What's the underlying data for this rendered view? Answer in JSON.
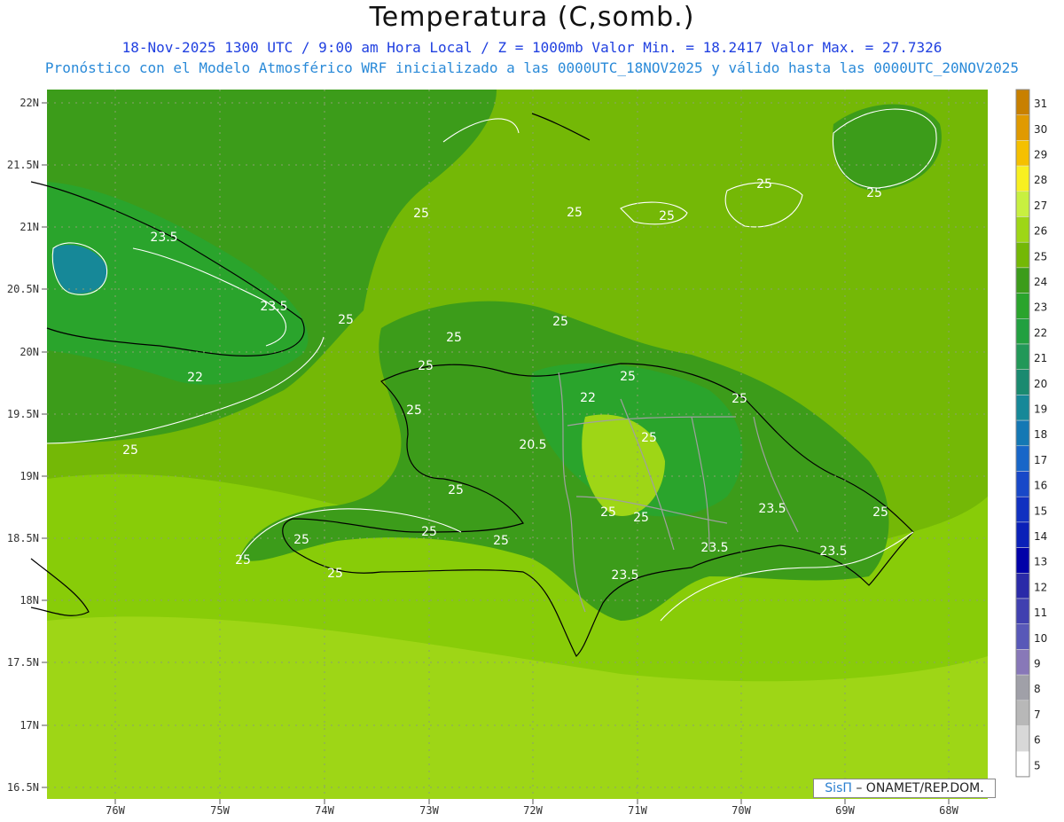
{
  "header": {
    "title": "Temperatura (C,somb.)",
    "subtitle": "18-Nov-2025  1300 UTC / 9:00 am Hora Local / Z = 1000mb   Valor Min. = 18.2417  Valor Max. = 27.7326",
    "note": "Pronóstico con el Modelo Atmosférico WRF inicializado a las 0000UTC_18NOV2025 y válido hasta las  0000UTC_20NOV2025"
  },
  "axes": {
    "lat_labels": [
      "22N",
      "21.5N",
      "21N",
      "20.5N",
      "20N",
      "19.5N",
      "19N",
      "18.5N",
      "18N",
      "17.5N",
      "17N",
      "16.5N"
    ],
    "lon_labels": [
      "76W",
      "75W",
      "74W",
      "73W",
      "72W",
      "71W",
      "70W",
      "69W",
      "68W"
    ]
  },
  "contour_labels": [
    "25",
    "25",
    "25",
    "25",
    "25",
    "25",
    "25",
    "25",
    "25",
    "25",
    "25",
    "25",
    "25",
    "25",
    "25",
    "25",
    "25",
    "25",
    "25",
    "25",
    "25",
    "25",
    "25",
    "23.5",
    "23.5",
    "23.5",
    "23.5",
    "23.5",
    "23.5",
    "22",
    "22",
    "20.5"
  ],
  "colorbar": {
    "levels": [
      "31",
      "30",
      "29",
      "28",
      "27",
      "26",
      "25",
      "24",
      "23",
      "22",
      "21",
      "20",
      "19",
      "18",
      "17",
      "16",
      "15",
      "14",
      "13",
      "12",
      "11",
      "10",
      "9",
      "8",
      "7",
      "6",
      "5"
    ],
    "colors": [
      "#c88000",
      "#e09a00",
      "#f5c000",
      "#f8f020",
      "#c8f040",
      "#9ed616",
      "#74b806",
      "#3c9c1a",
      "#2aa42c",
      "#22a040",
      "#229858",
      "#1a8a70",
      "#168898",
      "#1478b4",
      "#1866c8",
      "#1848c8",
      "#1030c0",
      "#0a20b8",
      "#0000a8",
      "#2a2aa8",
      "#4040b0",
      "#5858b8",
      "#8878b8",
      "#a0a0a8",
      "#b8b8b8",
      "#d8d8d8",
      "#ffffff"
    ]
  },
  "credit": {
    "brand": "SisΠ",
    "text": " – ONAMET/REP.DOM."
  }
}
